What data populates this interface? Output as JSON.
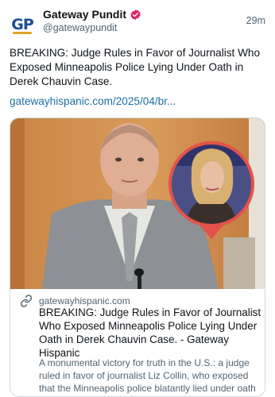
{
  "author": {
    "display_name": "Gateway Pundit",
    "handle": "@gatewaypundit",
    "avatar_text": "GP",
    "verified": true
  },
  "post": {
    "timestamp": "29m",
    "text": "BREAKING: Judge Rules in Favor of Journalist Who Exposed Minneapolis Police Lying Under Oath in Derek Chauvin Case.",
    "link": "gatewayhispanic.com/2025/04/br..."
  },
  "card": {
    "domain": "gatewayhispanic.com",
    "title": "BREAKING: Judge Rules in Favor of Journalist Who Exposed Minneapolis Police Lying Under Oath in Derek Chauvin Case. - Gateway Hispanic",
    "description": "A monumental victory for truth in the U.S.: a judge ruled in favor of journalist Liz Collin, who exposed that the Minneapolis police blatantly lied under oath",
    "link_icon": "link-icon"
  },
  "colors": {
    "link": "#1d6fa5",
    "muted": "#536471",
    "verified_badge": "#e0245e",
    "pin_red": "#e2534b"
  }
}
